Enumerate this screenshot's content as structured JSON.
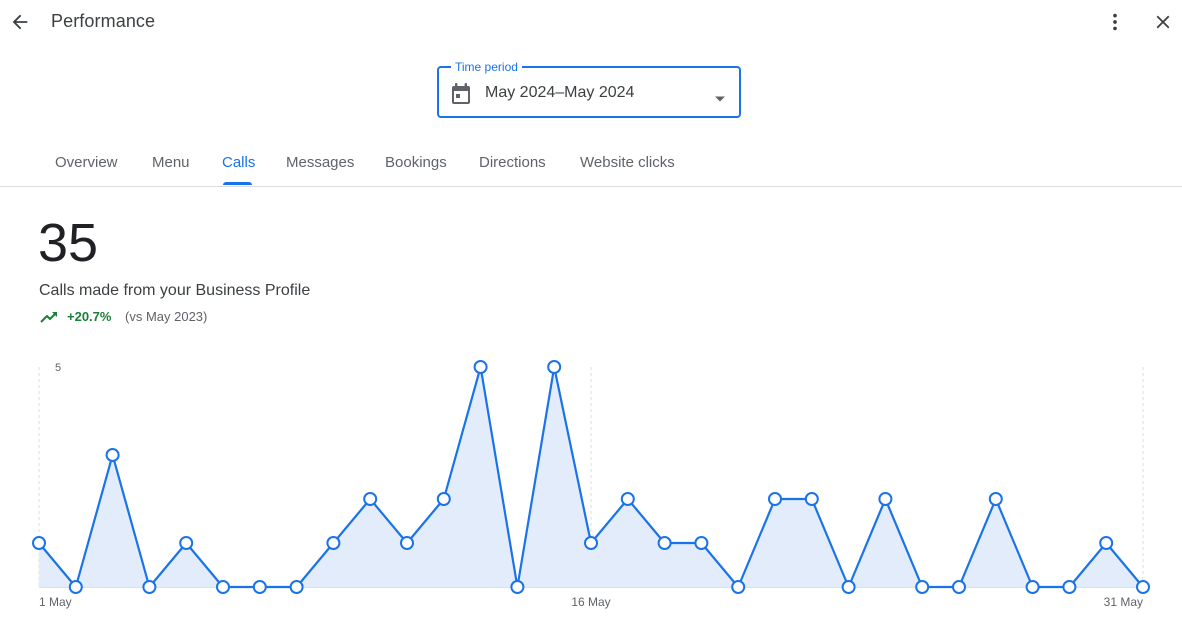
{
  "header": {
    "title": "Performance",
    "back_icon": "arrow-back-icon",
    "more_icon": "more-vert-icon",
    "close_icon": "close-icon"
  },
  "time_period": {
    "label": "Time period",
    "value": "May 2024–May 2024",
    "icon": "calendar-icon"
  },
  "tabs": [
    {
      "label": "Overview",
      "active": false
    },
    {
      "label": "Menu",
      "active": false
    },
    {
      "label": "Calls",
      "active": true
    },
    {
      "label": "Messages",
      "active": false
    },
    {
      "label": "Bookings",
      "active": false
    },
    {
      "label": "Directions",
      "active": false
    },
    {
      "label": "Website clicks",
      "active": false
    }
  ],
  "metric": {
    "value": "35",
    "label": "Calls made from your Business Profile",
    "change": "+20.7%",
    "comparison": "(vs May 2023)",
    "change_color": "#188038"
  },
  "colors": {
    "accent": "#1a73e8",
    "fill": "#e3ecfb"
  },
  "chart_data": {
    "type": "area",
    "x": [
      "1 May",
      "2 May",
      "3 May",
      "4 May",
      "5 May",
      "6 May",
      "7 May",
      "8 May",
      "9 May",
      "10 May",
      "11 May",
      "12 May",
      "13 May",
      "14 May",
      "15 May",
      "16 May",
      "17 May",
      "18 May",
      "19 May",
      "20 May",
      "21 May",
      "22 May",
      "23 May",
      "24 May",
      "25 May",
      "26 May",
      "27 May",
      "28 May",
      "29 May",
      "30 May",
      "31 May"
    ],
    "values": [
      1,
      0,
      3,
      0,
      1,
      0,
      0,
      0,
      1,
      2,
      1,
      2,
      5,
      0,
      5,
      1,
      2,
      1,
      1,
      0,
      2,
      2,
      0,
      2,
      0,
      0,
      2,
      0,
      0,
      1,
      0
    ],
    "x_tick_labels": [
      "1 May",
      "16 May",
      "31 May"
    ],
    "y_tick_labels": [
      "5"
    ],
    "ylim": [
      0,
      5
    ],
    "grid": "vertical dashed at ticks"
  }
}
